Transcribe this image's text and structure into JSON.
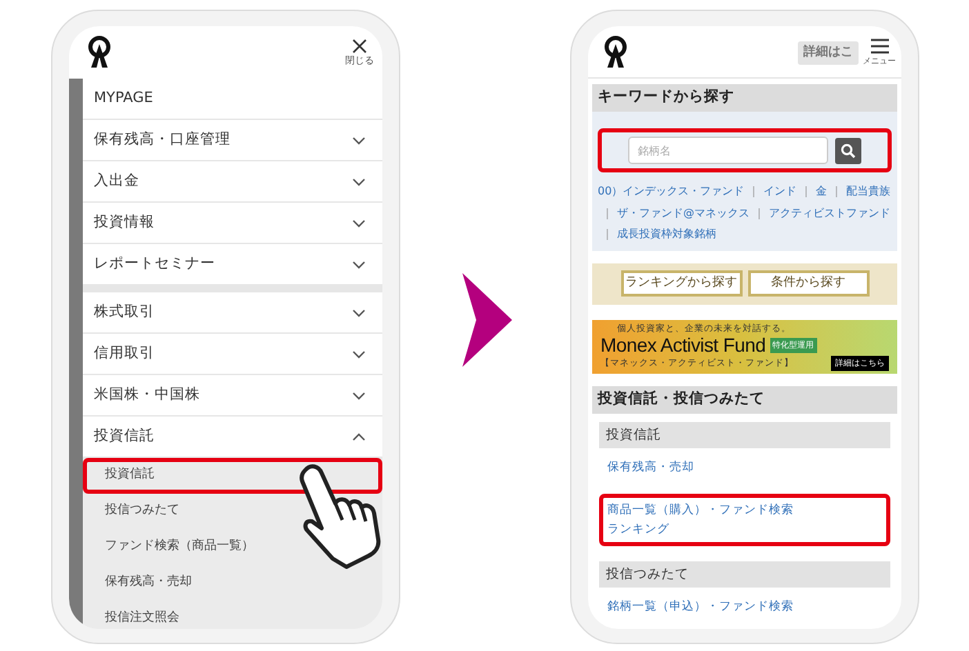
{
  "left_phone": {
    "close_label": "閉じる",
    "menu_groups": [
      {
        "items": [
          {
            "label": "MYPAGE",
            "kind": "link"
          },
          {
            "label": "保有残高・口座管理",
            "kind": "accordion",
            "expanded": false
          },
          {
            "label": "入出金",
            "kind": "accordion",
            "expanded": false
          },
          {
            "label": "投資情報",
            "kind": "accordion",
            "expanded": false
          },
          {
            "label": "レポートセミナー",
            "kind": "accordion",
            "expanded": false
          }
        ]
      },
      {
        "items": [
          {
            "label": "株式取引",
            "kind": "accordion",
            "expanded": false
          },
          {
            "label": "信用取引",
            "kind": "accordion",
            "expanded": false
          },
          {
            "label": "米国株・中国株",
            "kind": "accordion",
            "expanded": false
          },
          {
            "label": "投資信託",
            "kind": "accordion",
            "expanded": true,
            "children": [
              {
                "label": "投資信託",
                "highlighted": true
              },
              {
                "label": "投信つみたて",
                "highlighted": false
              },
              {
                "label": "ファンド検索（商品一覧）",
                "highlighted": false
              },
              {
                "label": "保有残高・売却",
                "highlighted": false
              },
              {
                "label": "投信注文照会",
                "highlighted": false
              }
            ]
          }
        ]
      }
    ]
  },
  "arrow": {
    "color": "#b4007e"
  },
  "right_phone": {
    "header_button": "詳細はこ",
    "menu_label": "メニュー",
    "keyword_section": {
      "title": "キーワードから探す",
      "search": {
        "placeholder": "銘柄名",
        "highlighted": true
      },
      "separator": "｜",
      "keywords": [
        "00）インデックス・ファンド",
        "インド",
        "金",
        "配当貴族",
        "ザ・ファンド@マネックス",
        "アクティビストファンド",
        "成長投資枠対象銘柄"
      ]
    },
    "buttons": [
      "ランキングから探す",
      "条件から探す"
    ],
    "banner": {
      "tagline": "個人投資家と、企業の未来を対話する。",
      "title": "Monex Activist Fund",
      "badge": "特化型運用",
      "subtitle": "【マネックス・アクティビスト・ファンド】",
      "link": "詳細はこちら"
    },
    "fund_section": {
      "title": "投資信託・投信つみたて",
      "subsections": [
        {
          "title": "投資信託",
          "link_groups": [
            {
              "highlighted": false,
              "links": [
                "保有残高・売却"
              ]
            },
            {
              "highlighted": true,
              "links": [
                "商品一覧（購入）・ファンド検索",
                "ランキング"
              ]
            }
          ]
        },
        {
          "title": "投信つみたて",
          "link_groups": [
            {
              "highlighted": false,
              "links": [
                "銘柄一覧（申込）・ファンド検索"
              ]
            }
          ]
        }
      ]
    }
  }
}
